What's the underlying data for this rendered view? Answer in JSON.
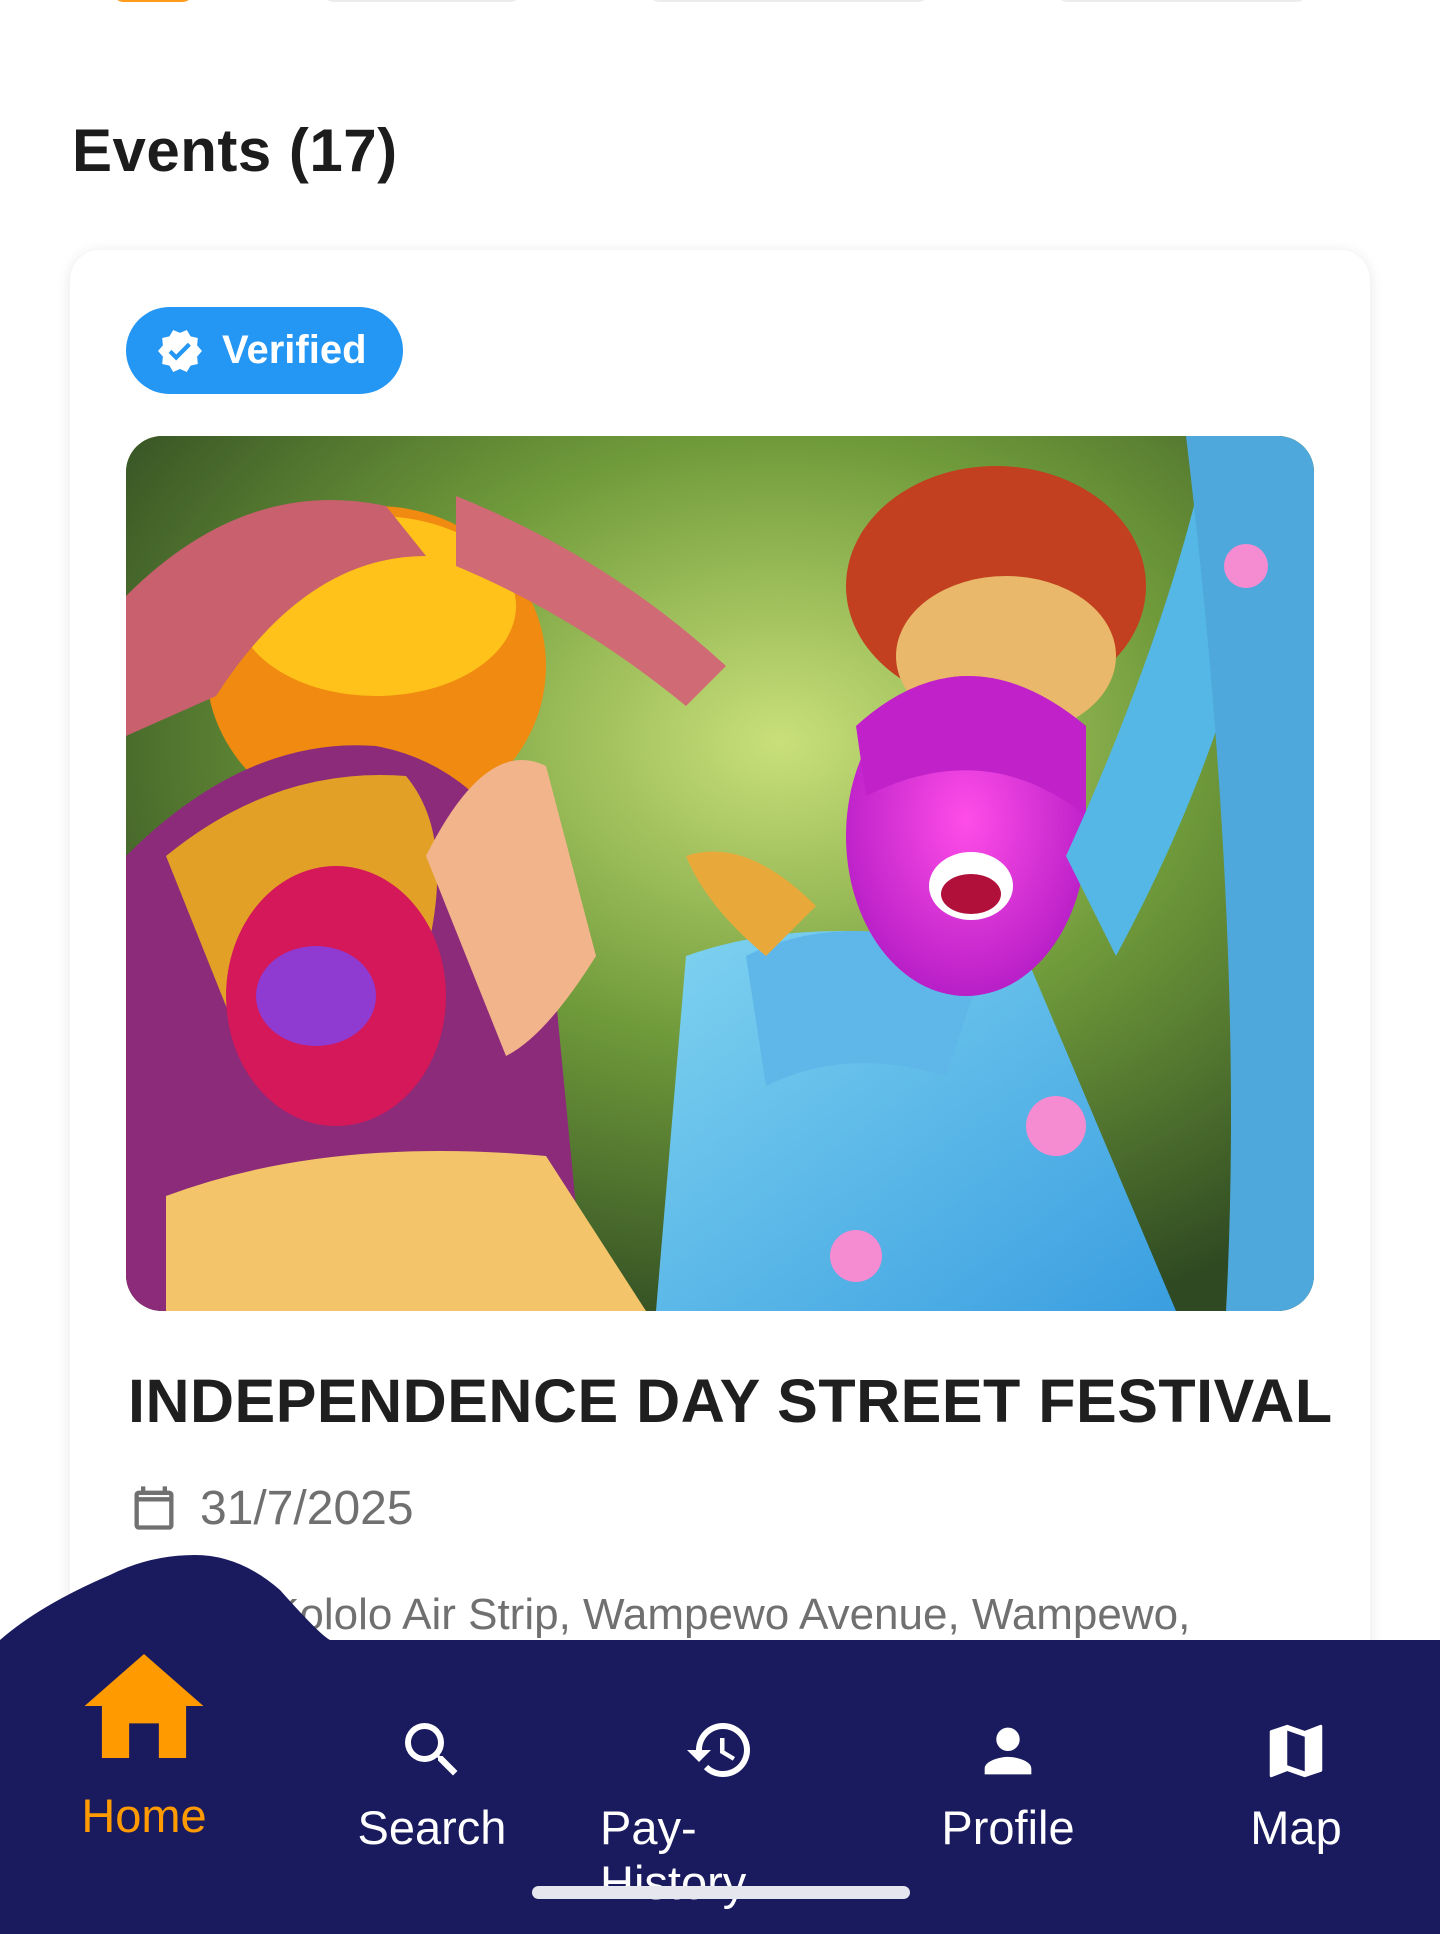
{
  "section": {
    "title": "Events (17)"
  },
  "event": {
    "badge": "Verified",
    "title": "INDEPENDENCE DAY STREET FESTIVAL",
    "date": "31/7/2025",
    "location": "Kololo Air Strip, Wampewo Avenue, Wampewo,",
    "image_description_icon": "festival-photo"
  },
  "nav": {
    "items": [
      {
        "label": "Home",
        "icon": "home-icon",
        "active": true
      },
      {
        "label": "Search",
        "icon": "search-icon",
        "active": false
      },
      {
        "label": "Pay-History",
        "icon": "history-icon",
        "active": false
      },
      {
        "label": "Profile",
        "icon": "person-icon",
        "active": false
      },
      {
        "label": "Map",
        "icon": "map-icon",
        "active": false
      }
    ]
  },
  "colors": {
    "accent": "#ff9a00",
    "nav_background": "#1a1a5e",
    "verified_badge": "#2496f3",
    "text_primary": "#1f1f1f",
    "text_secondary": "#707070"
  }
}
